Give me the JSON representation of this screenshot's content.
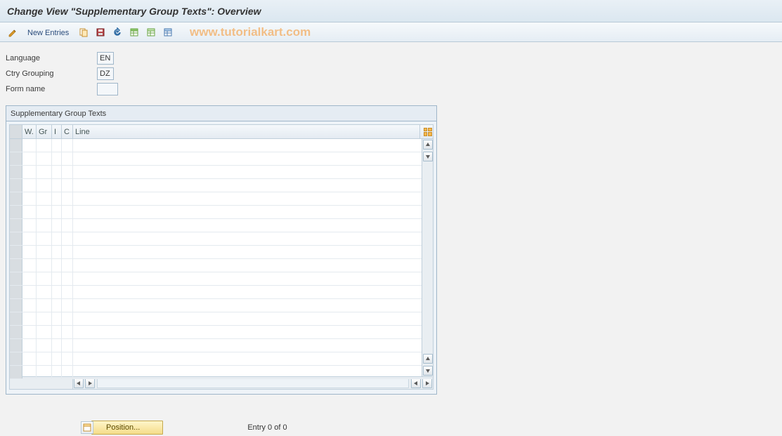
{
  "header": {
    "title": "Change View \"Supplementary Group Texts\": Overview"
  },
  "toolbar": {
    "new_entries_label": "New Entries"
  },
  "watermark": "www.tutorialkart.com",
  "form": {
    "language": {
      "label": "Language",
      "value": "EN"
    },
    "ctry_grouping": {
      "label": "Ctry Grouping",
      "value": "DZ"
    },
    "form_name": {
      "label": "Form name",
      "value": ""
    }
  },
  "table": {
    "title": "Supplementary Group Texts",
    "columns": {
      "w": "W.",
      "gr": "Gr",
      "i": "I",
      "c": "C",
      "line": "Line"
    },
    "row_count": 18
  },
  "footer": {
    "position_label": "Position...",
    "entry_text": "Entry 0 of 0"
  }
}
